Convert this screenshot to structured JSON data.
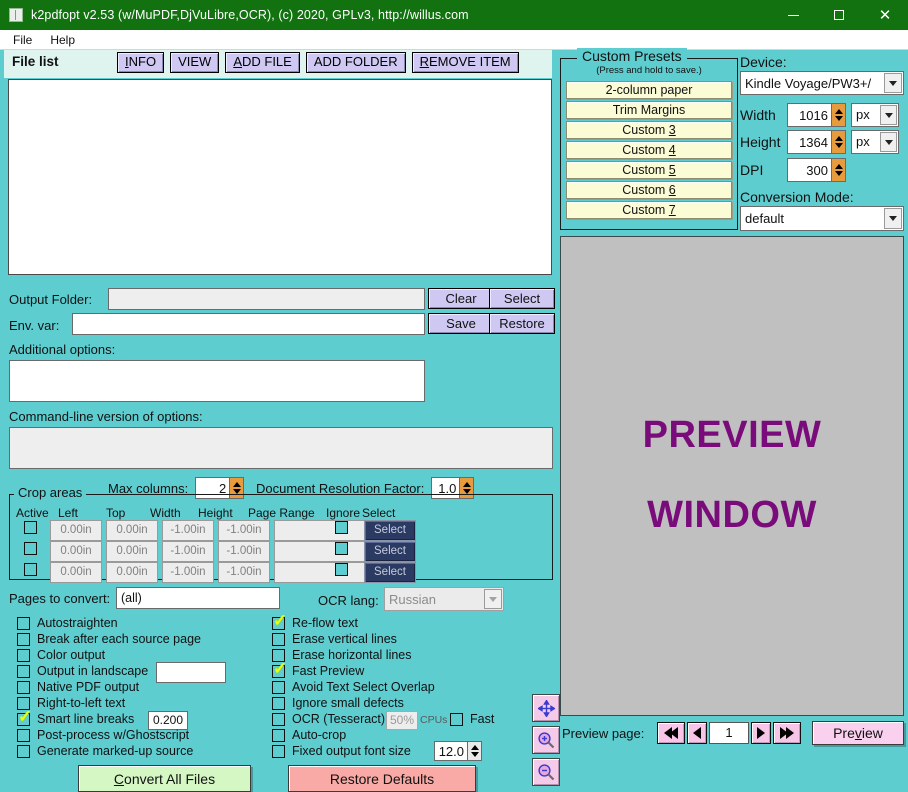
{
  "window": {
    "title": "k2pdfopt v2.53 (w/MuPDF,DjVuLibre,OCR), (c) 2020, GPLv3, http://willus.com",
    "minimize": "−",
    "maximize": "□",
    "close": "✕",
    "titlebar_color": "#11720f"
  },
  "menubar": {
    "items": [
      {
        "label": "File"
      },
      {
        "label": "Help"
      }
    ]
  },
  "filelist": {
    "label": "File list",
    "buttons": [
      {
        "label": "INFO",
        "accel": "I"
      },
      {
        "label": "VIEW",
        "accel": ""
      },
      {
        "label": "ADD FILE",
        "accel": "A"
      },
      {
        "label": "ADD FOLDER",
        "accel": ""
      },
      {
        "label": "REMOVE ITEM",
        "accel": "R"
      }
    ],
    "content": ""
  },
  "output": {
    "folder_label": "Output Folder:",
    "folder_value": "",
    "clear_label": "Clear",
    "select_label": "Select",
    "env_label": "Env. var:",
    "env_value": "",
    "save_label": "Save",
    "restore_label": "Restore",
    "additional_label": "Additional options:",
    "additional_value": "",
    "cmdline_label": "Command-line version of options:",
    "cmdline_value": ""
  },
  "columns": {
    "max_columns_label": "Max columns:",
    "max_columns_value": "2",
    "doc_res_label": "Document Resolution Factor:",
    "doc_res_value": "1.0"
  },
  "crop": {
    "group_title": "Crop areas",
    "headers": [
      "Active",
      "Left",
      "Top",
      "Width",
      "Height",
      "Page Range",
      "Ignore",
      "Select"
    ],
    "select_label": "Select",
    "rows": [
      {
        "active": false,
        "left": "0.00in",
        "top": "0.00in",
        "width": "-1.00in",
        "height": "-1.00in",
        "range": "",
        "ignore": false
      },
      {
        "active": false,
        "left": "0.00in",
        "top": "0.00in",
        "width": "-1.00in",
        "height": "-1.00in",
        "range": "",
        "ignore": false
      },
      {
        "active": false,
        "left": "0.00in",
        "top": "0.00in",
        "width": "-1.00in",
        "height": "-1.00in",
        "range": "",
        "ignore": false
      }
    ]
  },
  "pages": {
    "label": "Pages to convert:",
    "value": "(all)",
    "ocr_label": "OCR lang:",
    "ocr_value": "Russian"
  },
  "options_left": [
    {
      "label": "Autostraighten",
      "checked": false,
      "accel": ""
    },
    {
      "label": "Break after each source page",
      "checked": false,
      "accel": ""
    },
    {
      "label": "Color output",
      "checked": false,
      "accel": ""
    },
    {
      "label": "Output in landscape",
      "checked": false,
      "accel": "l",
      "field": ""
    },
    {
      "label": "Native PDF output",
      "checked": false,
      "accel": "N"
    },
    {
      "label": "Right-to-left text",
      "checked": false,
      "accel": ""
    },
    {
      "label": "Smart line breaks",
      "checked": true,
      "accel": "",
      "field": "0.200"
    },
    {
      "label": "Post-process w/Ghostscript",
      "checked": false,
      "accel": "P"
    },
    {
      "label": "Generate marked-up source",
      "checked": false,
      "accel": ""
    }
  ],
  "options_right": [
    {
      "label": "Re-flow text",
      "checked": true
    },
    {
      "label": "Erase vertical lines",
      "checked": false
    },
    {
      "label": "Erase horizontal lines",
      "checked": false
    },
    {
      "label": "Fast Preview",
      "checked": true
    },
    {
      "label": "Avoid Text Select Overlap",
      "checked": false
    },
    {
      "label": "Ignore small defects",
      "checked": false
    },
    {
      "label": "OCR (Tesseract)",
      "checked": false,
      "cpu_value": "50%",
      "cpu_label": "CPUs",
      "fast_label": "Fast",
      "fast_checked": false
    },
    {
      "label": "Auto-crop",
      "checked": false
    },
    {
      "label": "Fixed output font size",
      "checked": false,
      "field": "12.0"
    }
  ],
  "actions": {
    "convert_label": "Convert All Files",
    "convert_accel": "C",
    "convert_color": "#d4f7c4",
    "restore_label": "Restore Defaults",
    "restore_color": "#f9aaa6"
  },
  "presets": {
    "title": "Custom Presets",
    "subtitle": "(Press and hold to save.)",
    "items": [
      {
        "label": "2-column paper"
      },
      {
        "label": "Trim Margins"
      },
      {
        "label": "Custom 3"
      },
      {
        "label": "Custom 4"
      },
      {
        "label": "Custom 5"
      },
      {
        "label": "Custom 6"
      },
      {
        "label": "Custom 7"
      }
    ]
  },
  "device": {
    "label": "Device:",
    "value": "Kindle Voyage/PW3+/",
    "width_label": "Width",
    "width_value": "1016",
    "width_unit": "px",
    "height_label": "Height",
    "height_value": "1364",
    "height_unit": "px",
    "dpi_label": "DPI",
    "dpi_value": "300",
    "conv_label": "Conversion Mode:",
    "conv_value": "default"
  },
  "preview": {
    "line1": "PREVIEW",
    "line2": "WINDOW",
    "text_color": "#7a0b7a",
    "bg_color": "#c0c0c0",
    "tools": [
      {
        "name": "pan-icon"
      },
      {
        "name": "zoom-in-icon"
      },
      {
        "name": "zoom-out-icon"
      }
    ],
    "page_label": "Preview page:",
    "page_value": "1",
    "first_label": "◀◀",
    "prev_label": "◀",
    "next_label": "▶",
    "last_label": "▶▶",
    "preview_button": "Preview",
    "preview_accel": "v"
  }
}
